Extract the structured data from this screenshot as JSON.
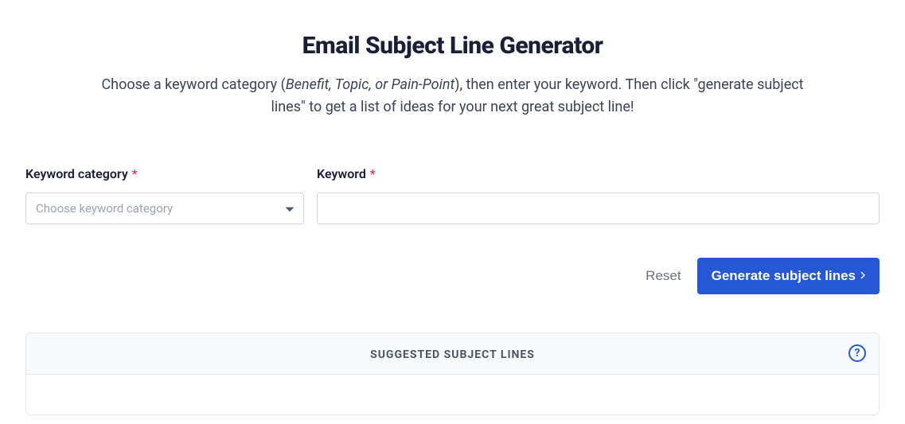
{
  "header": {
    "title": "Email Subject Line Generator",
    "subtitle_pre": "Choose a keyword category (",
    "subtitle_emphasis": "Benefit, Topic, or Pain-Point",
    "subtitle_post": "), then enter your keyword. Then click \"generate subject lines\" to get a list of ideas for your next great subject line!"
  },
  "form": {
    "category": {
      "label": "Keyword category",
      "required_mark": "*",
      "placeholder": "Choose keyword category",
      "value": ""
    },
    "keyword": {
      "label": "Keyword",
      "required_mark": "*",
      "value": ""
    }
  },
  "actions": {
    "reset_label": "Reset",
    "generate_label": "Generate subject lines"
  },
  "results": {
    "header_label": "SUGGESTED SUBJECT LINES",
    "help_char": "?"
  }
}
